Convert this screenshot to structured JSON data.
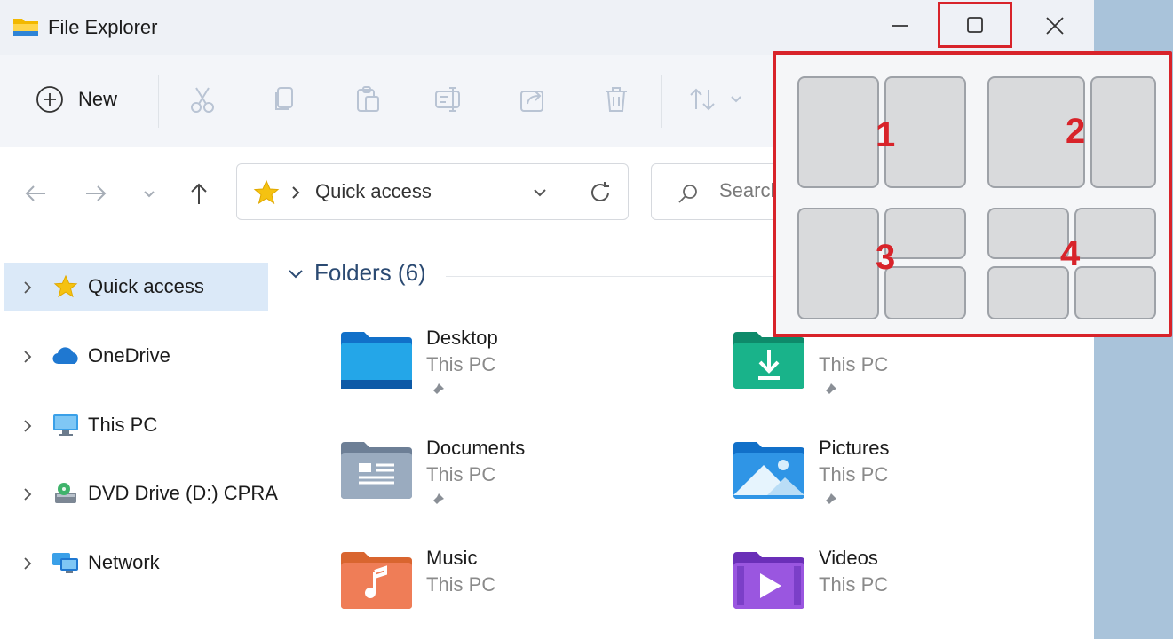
{
  "window": {
    "title": "File Explorer"
  },
  "toolbar": {
    "new_label": "New"
  },
  "address": {
    "location": "Quick access"
  },
  "search": {
    "placeholder": "Search Quick access"
  },
  "sidebar": {
    "items": [
      {
        "label": "Quick access",
        "icon": "star-icon"
      },
      {
        "label": "OneDrive",
        "icon": "cloud-icon"
      },
      {
        "label": "This PC",
        "icon": "monitor-icon"
      },
      {
        "label": "DVD Drive (D:) CPRA",
        "icon": "dvd-drive-icon"
      },
      {
        "label": "Network",
        "icon": "network-icon"
      }
    ]
  },
  "content": {
    "group_label": "Folders (6)",
    "folders": [
      {
        "name": "Desktop",
        "location": "This PC",
        "icon": "desktop-folder-icon"
      },
      {
        "name": "",
        "location": "This PC",
        "icon": "downloads-folder-icon"
      },
      {
        "name": "Documents",
        "location": "This PC",
        "icon": "documents-folder-icon"
      },
      {
        "name": "Pictures",
        "location": "This PC",
        "icon": "pictures-folder-icon"
      },
      {
        "name": "Music",
        "location": "This PC",
        "icon": "music-folder-icon"
      },
      {
        "name": "Videos",
        "location": "This PC",
        "icon": "videos-folder-icon"
      }
    ]
  },
  "snap_layouts": {
    "labels": [
      "1",
      "2",
      "3",
      "4"
    ]
  },
  "colors": {
    "annotation_red": "#d8232a",
    "selection": "#dbe9f8",
    "accent_blue": "#2b6cb0"
  }
}
